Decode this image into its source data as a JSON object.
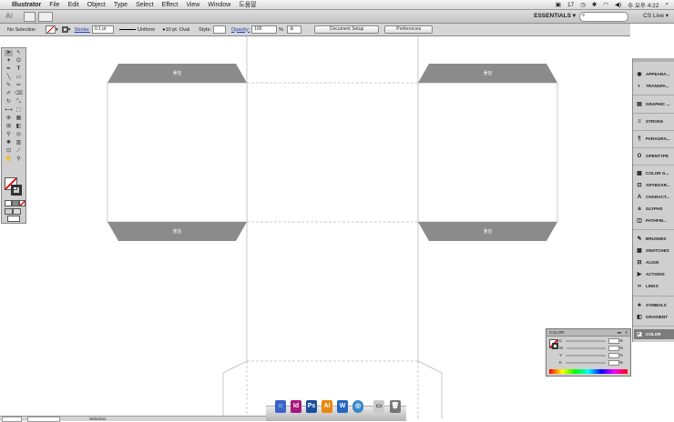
{
  "menubar": {
    "app_name": "Illustrator",
    "items": [
      "File",
      "Edit",
      "Object",
      "Type",
      "Select",
      "Effect",
      "View",
      "Window",
      "도움말"
    ],
    "status": {
      "badge": "17",
      "time": "수 오후 4:22"
    }
  },
  "appbar": {
    "logo": "Ai",
    "workspace": "ESSENTIALS ▾",
    "search_placeholder": "",
    "cslive": "CS Live ▾"
  },
  "control": {
    "selection": "No Selection",
    "stroke_label": "Stroke:",
    "stroke_value": "0.1 pt",
    "uniform": "Uniform",
    "brush": "10 pt. Oval",
    "style_label": "Style:",
    "opacity_label": "Opacity:",
    "opacity_value": "100",
    "opacity_unit": "%",
    "document_setup": "Document Setup",
    "preferences": "Preferences"
  },
  "artwork": {
    "tab_label": "풀칠"
  },
  "dock_panels": [
    {
      "label": "APPEARA...",
      "icon": "appearance-icon"
    },
    {
      "label": "TRANSPA...",
      "icon": "transparency-icon"
    },
    {
      "label": "GRAPHIC ...",
      "icon": "graphic-styles-icon"
    },
    {
      "label": "STROKE",
      "icon": "stroke-icon"
    },
    {
      "label": "PARAGRA...",
      "icon": "paragraph-icon"
    },
    {
      "label": "OPENTYPE",
      "icon": "opentype-icon"
    },
    {
      "label": "COLOR G...",
      "icon": "color-guide-icon"
    },
    {
      "label": "ARTBOAR...",
      "icon": "artboards-icon"
    },
    {
      "label": "CHARACT...",
      "icon": "character-icon"
    },
    {
      "label": "GLYPHS",
      "icon": "glyphs-icon"
    },
    {
      "label": "PATHFIN...",
      "icon": "pathfinder-icon"
    },
    {
      "label": "BRUSHES",
      "icon": "brushes-icon"
    },
    {
      "label": "SWATCHES",
      "icon": "swatches-icon"
    },
    {
      "label": "ALIGN",
      "icon": "align-icon"
    },
    {
      "label": "ACTIONS",
      "icon": "actions-icon"
    },
    {
      "label": "LINKS",
      "icon": "links-icon"
    },
    {
      "label": "SYMBOLS",
      "icon": "symbols-icon"
    },
    {
      "label": "GRADIENT",
      "icon": "gradient-icon"
    },
    {
      "label": "COLOR",
      "icon": "color-icon"
    }
  ],
  "color_panel": {
    "title": "COLOR",
    "channels": [
      "C",
      "M",
      "Y",
      "K"
    ],
    "unit": "%"
  },
  "statusbar": {
    "zoom": "",
    "tool": "Selection"
  },
  "colors": {
    "tab_gray": "#8b8b8b",
    "dock_active": "#7c7c7c"
  }
}
